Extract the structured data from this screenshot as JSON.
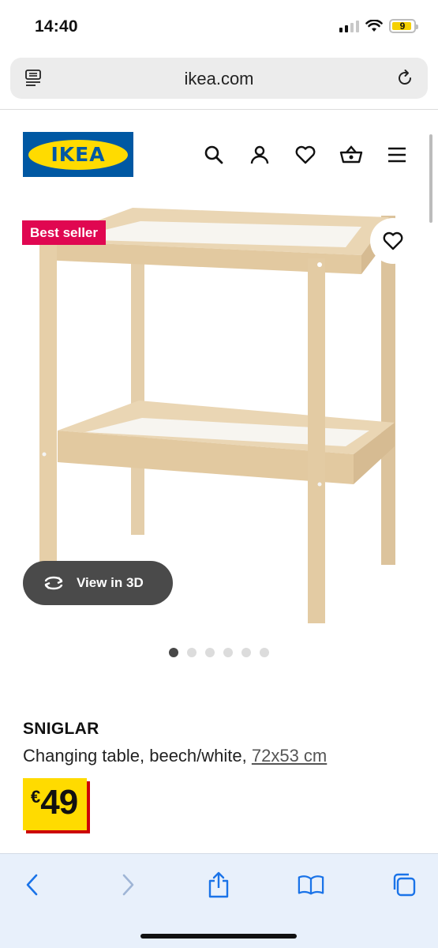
{
  "status_bar": {
    "time": "14:40",
    "battery_level": "9",
    "battery_fraction": 0.09,
    "signal_bars_active": 2,
    "signal_bars_total": 4
  },
  "browser": {
    "url": "ikea.com"
  },
  "header": {
    "logo_text": "IKEA",
    "brand_colors": {
      "blue": "#0058a3",
      "yellow": "#ffdb00"
    },
    "icons": [
      "search-icon",
      "user-icon",
      "heart-icon",
      "basket-icon",
      "menu-icon"
    ]
  },
  "product": {
    "badge": "Best seller",
    "badge_color": "#e00751",
    "view_3d_label": "View in 3D",
    "carousel": {
      "count": 6,
      "active_index": 0
    },
    "name": "SNIGLAR",
    "description": "Changing table, beech/white, ",
    "size": "72x53 cm",
    "price_currency": "€",
    "price_value": "49"
  },
  "toolbar": {
    "icons": [
      "back-icon",
      "forward-icon",
      "share-icon",
      "bookmarks-icon",
      "tabs-icon"
    ]
  }
}
